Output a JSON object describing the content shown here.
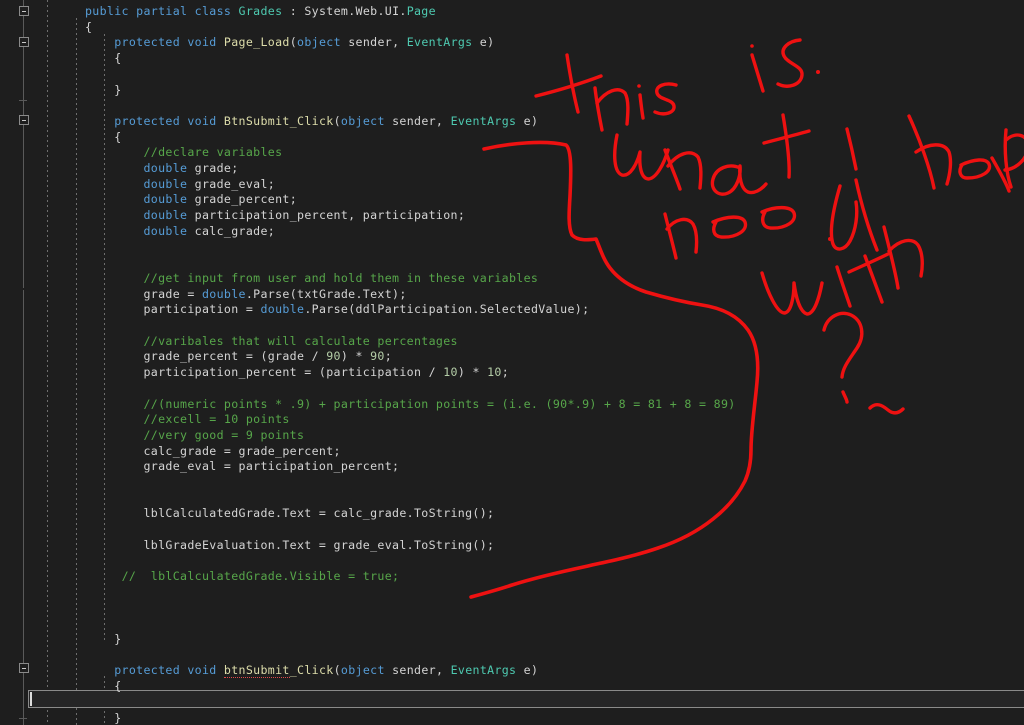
{
  "editor": {
    "theme_background": "#1e1e1e",
    "current_line_background": "#252526",
    "caret_color": "#dcdcdc",
    "colors": {
      "keyword": "#569cd6",
      "type": "#4ec9b0",
      "method": "#dcdcaa",
      "comment": "#57a64a",
      "number": "#b5cea8",
      "plain": "#d4d4d4",
      "error_squiggle": "#e04a4a",
      "annotation_ink": "#ee1111"
    }
  },
  "code": {
    "lines": [
      {
        "indent": 85,
        "segments": [
          {
            "t": "public ",
            "c": "k"
          },
          {
            "t": "partial ",
            "c": "k"
          },
          {
            "t": "class ",
            "c": "k"
          },
          {
            "t": "Grades",
            "c": "t"
          },
          {
            "t": " : ",
            "c": "p"
          },
          {
            "t": "System.Web.UI.",
            "c": "p"
          },
          {
            "t": "Page",
            "c": "t"
          }
        ]
      },
      {
        "indent": 85,
        "segments": [
          {
            "t": "{",
            "c": "p"
          }
        ]
      },
      {
        "indent": 85,
        "segments": [
          {
            "t": "    ",
            "c": "p"
          },
          {
            "t": "protected ",
            "c": "k"
          },
          {
            "t": "void ",
            "c": "k"
          },
          {
            "t": "Page_Load",
            "c": "m"
          },
          {
            "t": "(",
            "c": "p"
          },
          {
            "t": "object",
            "c": "k"
          },
          {
            "t": " sender, ",
            "c": "p"
          },
          {
            "t": "EventArgs",
            "c": "t"
          },
          {
            "t": " e)",
            "c": "p"
          }
        ]
      },
      {
        "indent": 85,
        "segments": [
          {
            "t": "    {",
            "c": "p"
          }
        ]
      },
      {
        "indent": 85,
        "segments": [
          {
            "t": "",
            "c": "p"
          }
        ]
      },
      {
        "indent": 85,
        "segments": [
          {
            "t": "    }",
            "c": "p"
          }
        ]
      },
      {
        "indent": 85,
        "segments": [
          {
            "t": "",
            "c": "p"
          }
        ]
      },
      {
        "indent": 85,
        "segments": [
          {
            "t": "    ",
            "c": "p"
          },
          {
            "t": "protected ",
            "c": "k"
          },
          {
            "t": "void ",
            "c": "k"
          },
          {
            "t": "BtnSubmit_Click",
            "c": "m"
          },
          {
            "t": "(",
            "c": "p"
          },
          {
            "t": "object",
            "c": "k"
          },
          {
            "t": " sender, ",
            "c": "p"
          },
          {
            "t": "EventArgs",
            "c": "t"
          },
          {
            "t": " e)",
            "c": "p"
          }
        ]
      },
      {
        "indent": 85,
        "segments": [
          {
            "t": "    {",
            "c": "p"
          }
        ]
      },
      {
        "indent": 85,
        "segments": [
          {
            "t": "        ",
            "c": "p"
          },
          {
            "t": "//declare variables",
            "c": "c"
          }
        ]
      },
      {
        "indent": 85,
        "segments": [
          {
            "t": "        ",
            "c": "p"
          },
          {
            "t": "double",
            "c": "k"
          },
          {
            "t": " grade;",
            "c": "p"
          }
        ]
      },
      {
        "indent": 85,
        "segments": [
          {
            "t": "        ",
            "c": "p"
          },
          {
            "t": "double",
            "c": "k"
          },
          {
            "t": " grade_eval;",
            "c": "p"
          }
        ]
      },
      {
        "indent": 85,
        "segments": [
          {
            "t": "        ",
            "c": "p"
          },
          {
            "t": "double",
            "c": "k"
          },
          {
            "t": " grade_percent;",
            "c": "p"
          }
        ]
      },
      {
        "indent": 85,
        "segments": [
          {
            "t": "        ",
            "c": "p"
          },
          {
            "t": "double",
            "c": "k"
          },
          {
            "t": " participation_percent, participation;",
            "c": "p"
          }
        ]
      },
      {
        "indent": 85,
        "segments": [
          {
            "t": "        ",
            "c": "p"
          },
          {
            "t": "double",
            "c": "k"
          },
          {
            "t": " calc_grade;",
            "c": "p"
          }
        ]
      },
      {
        "indent": 85,
        "segments": [
          {
            "t": "",
            "c": "p"
          }
        ]
      },
      {
        "indent": 85,
        "segments": [
          {
            "t": "",
            "c": "p"
          }
        ]
      },
      {
        "indent": 85,
        "segments": [
          {
            "t": "        ",
            "c": "p"
          },
          {
            "t": "//get input from user and hold them in these variables",
            "c": "c"
          }
        ]
      },
      {
        "indent": 85,
        "segments": [
          {
            "t": "        grade = ",
            "c": "p"
          },
          {
            "t": "double",
            "c": "k"
          },
          {
            "t": ".Parse(txtGrade.Text);",
            "c": "p"
          }
        ]
      },
      {
        "indent": 85,
        "segments": [
          {
            "t": "        participation = ",
            "c": "p"
          },
          {
            "t": "double",
            "c": "k"
          },
          {
            "t": ".Parse(ddlParticipation.SelectedValue);",
            "c": "p"
          }
        ]
      },
      {
        "indent": 85,
        "segments": [
          {
            "t": "",
            "c": "p"
          }
        ]
      },
      {
        "indent": 85,
        "segments": [
          {
            "t": "        ",
            "c": "p"
          },
          {
            "t": "//varibales that will calculate percentages",
            "c": "c"
          }
        ]
      },
      {
        "indent": 85,
        "segments": [
          {
            "t": "        grade_percent = (grade / ",
            "c": "p"
          },
          {
            "t": "90",
            "c": "n"
          },
          {
            "t": ") * ",
            "c": "p"
          },
          {
            "t": "90",
            "c": "n"
          },
          {
            "t": ";",
            "c": "p"
          }
        ]
      },
      {
        "indent": 85,
        "segments": [
          {
            "t": "        participation_percent = (participation / ",
            "c": "p"
          },
          {
            "t": "10",
            "c": "n"
          },
          {
            "t": ") * ",
            "c": "p"
          },
          {
            "t": "10",
            "c": "n"
          },
          {
            "t": ";",
            "c": "p"
          }
        ]
      },
      {
        "indent": 85,
        "segments": [
          {
            "t": "",
            "c": "p"
          }
        ]
      },
      {
        "indent": 85,
        "segments": [
          {
            "t": "        ",
            "c": "p"
          },
          {
            "t": "//(numeric points * .9) + participation points = (i.e. (90*.9) + 8 = 81 + 8 = 89)",
            "c": "c"
          }
        ]
      },
      {
        "indent": 85,
        "segments": [
          {
            "t": "        ",
            "c": "p"
          },
          {
            "t": "//excell = 10 points",
            "c": "c"
          }
        ]
      },
      {
        "indent": 85,
        "segments": [
          {
            "t": "        ",
            "c": "p"
          },
          {
            "t": "//very good = 9 points",
            "c": "c"
          }
        ]
      },
      {
        "indent": 85,
        "segments": [
          {
            "t": "        calc_grade = grade_percent;",
            "c": "p"
          }
        ]
      },
      {
        "indent": 85,
        "segments": [
          {
            "t": "        grade_eval = participation_percent;",
            "c": "p"
          }
        ]
      },
      {
        "indent": 85,
        "segments": [
          {
            "t": "",
            "c": "p"
          }
        ]
      },
      {
        "indent": 85,
        "segments": [
          {
            "t": "",
            "c": "p"
          }
        ]
      },
      {
        "indent": 85,
        "segments": [
          {
            "t": "        lblCalculatedGrade.Text = calc_grade.ToString();",
            "c": "p"
          }
        ]
      },
      {
        "indent": 85,
        "segments": [
          {
            "t": "",
            "c": "p"
          }
        ]
      },
      {
        "indent": 85,
        "segments": [
          {
            "t": "        lblGradeEvaluation.Text = grade_eval.ToString();",
            "c": "p"
          }
        ]
      },
      {
        "indent": 85,
        "segments": [
          {
            "t": "",
            "c": "p"
          }
        ]
      },
      {
        "indent": 85,
        "segments": [
          {
            "t": "     ",
            "c": "p"
          },
          {
            "t": "//  lblCalculatedGrade.Visible = true;",
            "c": "c"
          }
        ]
      },
      {
        "indent": 85,
        "segments": [
          {
            "t": "",
            "c": "p"
          }
        ]
      },
      {
        "indent": 85,
        "segments": [
          {
            "t": "",
            "c": "p"
          }
        ]
      },
      {
        "indent": 85,
        "segments": [
          {
            "t": "",
            "c": "p"
          }
        ]
      },
      {
        "indent": 85,
        "segments": [
          {
            "t": "    }",
            "c": "p"
          }
        ]
      },
      {
        "indent": 85,
        "segments": [
          {
            "t": "",
            "c": "p"
          }
        ]
      },
      {
        "indent": 85,
        "segments": [
          {
            "t": "    ",
            "c": "p"
          },
          {
            "t": "protected ",
            "c": "k"
          },
          {
            "t": "void ",
            "c": "k"
          },
          {
            "t": "btnSubmit",
            "c": "m",
            "err": true
          },
          {
            "t": "_Click",
            "c": "m"
          },
          {
            "t": "(",
            "c": "p"
          },
          {
            "t": "object",
            "c": "k"
          },
          {
            "t": " sender, ",
            "c": "p"
          },
          {
            "t": "EventArgs",
            "c": "t"
          },
          {
            "t": " e)",
            "c": "p"
          }
        ]
      },
      {
        "indent": 85,
        "segments": [
          {
            "t": "    {",
            "c": "p"
          }
        ]
      },
      {
        "indent": 85,
        "segments": [
          {
            "t": "",
            "c": "p"
          }
        ]
      },
      {
        "indent": 85,
        "segments": [
          {
            "t": "    }",
            "c": "p"
          }
        ]
      }
    ]
  },
  "annotation": {
    "ink_color": "#ee1111",
    "handwritten_text": "This is what i need help with ?",
    "words": [
      "This",
      "is",
      "what",
      "i",
      "need",
      "help",
      "with",
      "?"
    ],
    "shapes": [
      "handwritten-note",
      "pointer-bracket-curve",
      "tilde-mark"
    ]
  },
  "gutter": {
    "fold_markers": [
      "collapse-box",
      "collapse-box",
      "collapse-box",
      "collapse-box"
    ],
    "indent_guide_count": 3
  },
  "caret": {
    "line_index": 44,
    "column": 1
  }
}
